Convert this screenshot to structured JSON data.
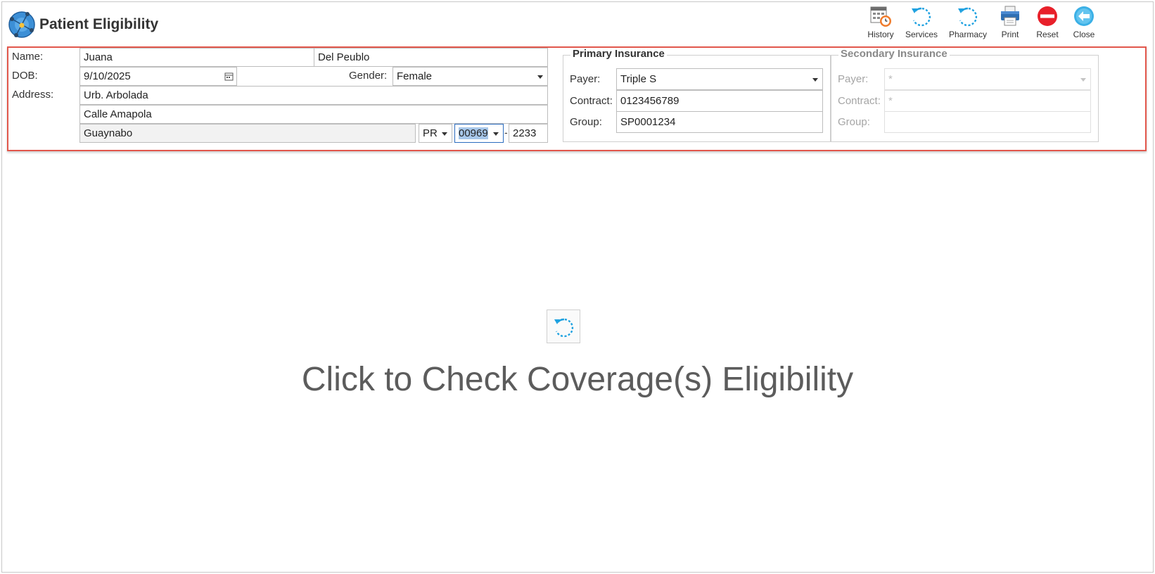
{
  "window": {
    "title": "Patient Eligibility"
  },
  "toolbar": {
    "history": "History",
    "services": "Services",
    "pharmacy": "Pharmacy",
    "print": "Print",
    "reset": "Reset",
    "close": "Close"
  },
  "patient": {
    "name_label": "Name:",
    "first_name": "Juana",
    "last_name": "Del Peublo",
    "dob_label": "DOB:",
    "dob": "9/10/2025",
    "gender_label": "Gender:",
    "gender": "Female",
    "address_label": "Address:",
    "address_line1": "Urb. Arbolada",
    "address_line2": "Calle Amapola",
    "city": "Guaynabo",
    "state": "PR",
    "zip": "00969",
    "zip_separator": "-",
    "zip_ext": "2233"
  },
  "primary_insurance": {
    "title": "Primary Insurance",
    "payer_label": "Payer:",
    "payer": "Triple S",
    "contract_label": "Contract:",
    "contract": "0123456789",
    "group_label": "Group:",
    "group": "SP0001234"
  },
  "secondary_insurance": {
    "title": "Secondary Insurance",
    "payer_label": "Payer:",
    "payer": "*",
    "contract_label": "Contract:",
    "contract": "*",
    "group_label": "Group:",
    "group": ""
  },
  "main": {
    "check_text": "Click to Check Coverage(s) Eligibility"
  },
  "colors": {
    "accent_blue": "#1ea1e0",
    "reset_red": "#e8202a",
    "highlight_border": "#e2574c"
  }
}
